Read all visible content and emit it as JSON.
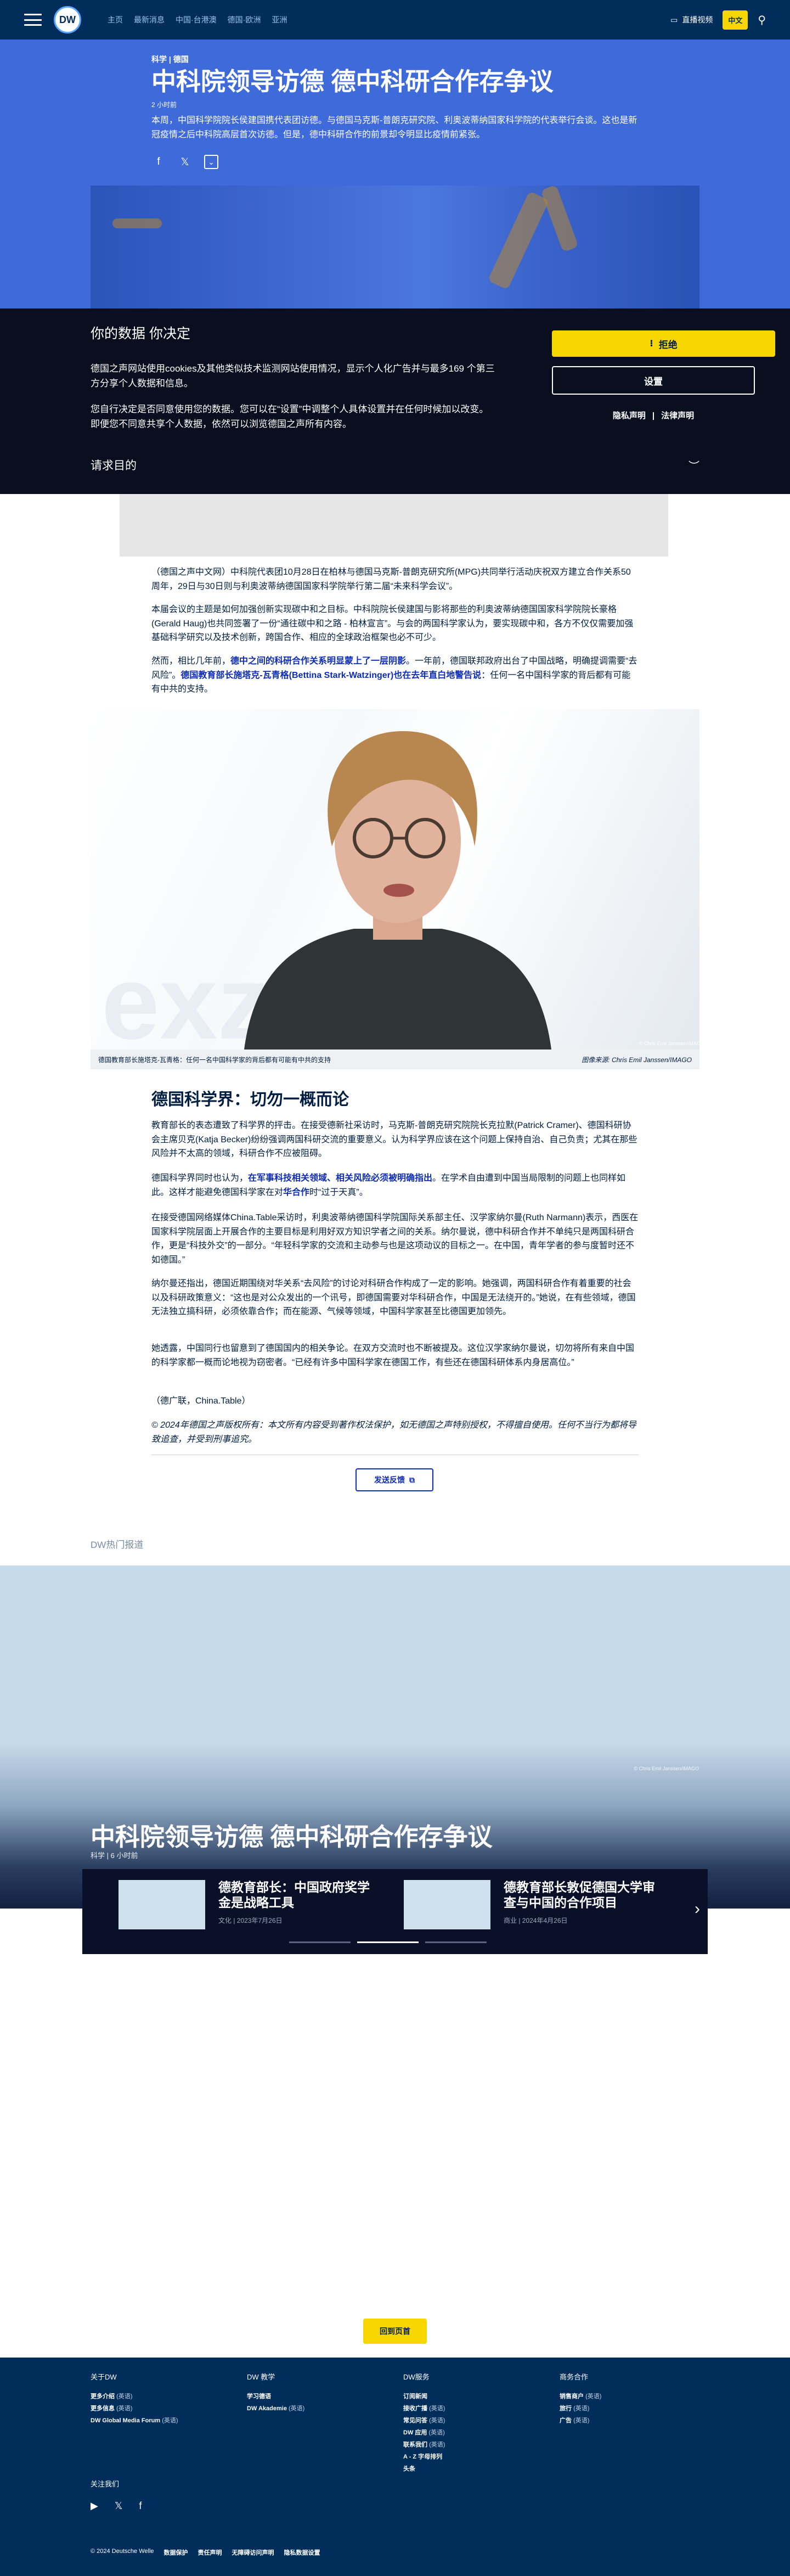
{
  "nav": {
    "links": [
      "主页",
      "最新消息",
      "中国·台港澳",
      "德国·欧洲",
      "亚洲"
    ],
    "live_tv": "直播视频",
    "lang_label": "中文",
    "logo_text": "DW"
  },
  "article": {
    "breadcrumb": "科学 | 德国",
    "title": "中科院领导访德 德中科研合作存争议",
    "meta": "2 小时前",
    "lede": "本周，中国科学院院长侯建国携代表团访德。与德国马克斯-普朗克研究院、利奥波蒂纳国家科学院的代表举行会谈。这也是新冠疫情之后中科院高层首次访德。但是，德中科研合作的前景却令明显比疫情前紧张。",
    "body1": "（德国之声中文网）中科院代表团10月28日在柏林与德国马克斯-普朗克研究所(MPG)共同举行活动庆祝双方建立合作关系50周年，29日与30日则与利奥波蒂纳德国国家科学院举行第二届“未来科学会议”。",
    "body2": "本届会议的主题是如何加强创新实现碳中和之目标。中科院院长侯建国与影将那些的利奥波蒂纳德国国家科学院院长豪格(Gerald Haug)也共同签署了一份“通往碳中和之路 - 柏林宣言”。与会的两国科学家认为，要实现碳中和，各方不仅仅需要加强基础科学研究以及技术创新，跨国合作、相应的全球政治框架也必不可少。",
    "body3_plain1": "然而，相比几年前，",
    "body3_link1": "德中之间的科研合作关系明显蒙上了一层阴影",
    "body3_plain2": "。一年前，德国联邦政府出台了中国战略，明确提调需要“去风险”。",
    "body3_link2": "德国教育部长施塔克-瓦青格(Bettina Stark-Watzinger)也在去年直白地警告说",
    "body3_plain3": "：任何一名中国科学家的背后都有可能有中共的支持。",
    "caption": "德国教育部长施塔克-瓦青格：任何一名中国科学家的背后都有可能有中共的支持",
    "credit": "图像来源: Chris Emil Janssen/IMAGO",
    "photo_credit_small": "© Chris Emil Janssen/IMAGO",
    "h2": "德国科学界：切勿一概而论",
    "body4": "教育部长的表态遭致了科学界的抨击。在接受德新社采访时，马克斯-普朗克研究院院长克拉默(Patrick Cramer)、德国科研协会主席贝克(Katja Becker)纷纷强调两国科研交流的重要意义。认为科学界应该在这个问题上保持自治、自己负责；尤其在那些风险并不太高的领域，科研合作不应被阻碍。",
    "body5_plain1": "德国科学界同时也认为，",
    "body5_link1": "在军事科技相关领域、相关风险必须被明确指出",
    "body5_plain2": "。在学术自由遭到中国当局限制的问题上也同样如此。这样才能避免德国科学家在对",
    "body5_link2": "华合作",
    "body5_plain3": "时“过于天真”。",
    "body6": "在接受德国网络媒体China.Table采访时，利奥波蒂纳德国科学院国际关系部主任、汉学家纳尔曼(Ruth Narmann)表示，西医在国家科学院层面上开展合作的主要目标是利用好双方知识学者之间的关系。纳尔曼说，德中科研合作并不单纯只是两国科研合作，更是“科技外交”的一部分。“年轻科学家的交流和主动参与也是这项动议的目标之一。在中国，青年学者的参与度暂时还不如德国。”",
    "body7": "纳尔曼还指出，德国近期围绕对华关系“去风险”的讨论对科研合作构成了一定的影响。她强调，两国科研合作有着重要的社会以及科研政策意义：“这也是对公众发出的一个讯号，即德国需要对华科研合作，中国是无法绕开的。”她说，在有些领域，德国无法独立搞科研，必须依靠合作；而在能源、气候等领域，中国科学家甚至比德国更加领先。",
    "body8": "她透露，中国同行也留意到了德国国内的相关争论。在双方交流时也不断被提及。这位汉学家纳尔曼说，切勿将所有来自中国的科学家都一概而论地视为窃密者。“已经有许多中国科学家在德国工作，有些还在德国科研体系内身居高位。”",
    "body9": "（德广联，China.Table）",
    "copyright": "© 2024年德国之声版权所有：本文所有内容受到著作权法保护，如无德国之声特别授权，不得擅自使用。任何不当行为都将导致追查，并受到刑事追究。",
    "feedback": "发送反馈"
  },
  "consent": {
    "title": "你的数据 你决定",
    "text1": "德国之声网站使用cookies及其他类似技术监测网站使用情况，显示个人化广告并与最多169 个第三方分享个人数据和信息。",
    "text2": "您自行决定是否同意使用您的数据。您可以在“设置”中调整个人具体设置并在任何时候加以改变。即便您不同意共享个人数据，依然可以浏览德国之声所有内容。",
    "reject": "拒绝",
    "settings": "设置",
    "privacy": "隐私声明",
    "separator": "|",
    "legal": "法律声明",
    "purposes": "请求目的"
  },
  "hot": {
    "section_title": "DW热门报道",
    "hero_title": "中科院领导访德 德中科研合作存争议",
    "hero_meta": "科学 | 6 小时前",
    "hero_credit": "© Chris Emil Janssen/IMAGO",
    "cards": [
      {
        "title": "德教育部长：中国政府奖学金是战略工具",
        "meta": "文化 | 2023年7月26日"
      },
      {
        "title": "德教育部长敦促德国大学审查与中国的合作项目",
        "meta": "商业 | 2024年4月26日"
      }
    ]
  },
  "back_to_top": "回到页首",
  "footer": {
    "col1": {
      "title": "关于DW",
      "items": [
        {
          "label": "更多介绍",
          "suffix": "(英语)"
        },
        {
          "label": "更多信息",
          "suffix": "(英语)"
        },
        {
          "label": "DW Global Media Forum",
          "suffix": "(英语)"
        }
      ]
    },
    "col2": {
      "title": "DW 教学",
      "items": [
        {
          "label": "学习德语",
          "suffix": ""
        },
        {
          "label": "DW Akademie",
          "suffix": "(英语)"
        }
      ]
    },
    "col3": {
      "title": "DW服务",
      "items": [
        {
          "label": "订阅新闻",
          "suffix": ""
        },
        {
          "label": "接收广播",
          "suffix": "(英语)"
        },
        {
          "label": "常见问答",
          "suffix": "(英语)"
        },
        {
          "label": "DW 应用",
          "suffix": "(英语)"
        },
        {
          "label": "联系我们",
          "suffix": "(英语)"
        },
        {
          "label": "A - Z 字母排列",
          "suffix": ""
        },
        {
          "label": "头条",
          "suffix": ""
        }
      ]
    },
    "col4": {
      "title": "商务合作",
      "items": [
        {
          "label": "销售商户",
          "suffix": "(英语)"
        },
        {
          "label": "旅行",
          "suffix": "(英语)"
        },
        {
          "label": "广告",
          "suffix": "(英语)"
        }
      ]
    },
    "follow": "关注我们",
    "legal": [
      "© 2024 Deutsche Welle",
      "数据保护",
      "责任声明",
      "无障碍访问声明",
      "隐私数据设置"
    ]
  },
  "colors": {
    "accent_yellow": "#f8d700",
    "dw_blue": "#002d5a",
    "link_blue": "#0c2bb7"
  }
}
